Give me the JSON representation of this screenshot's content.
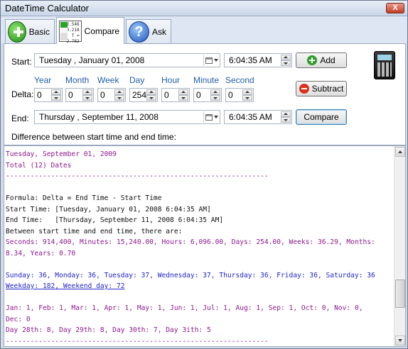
{
  "window": {
    "title": "DateTime Calculator",
    "close_label": "X"
  },
  "tabs": [
    {
      "label": "Basic",
      "icon": "plus-circle-icon"
    },
    {
      "label": "Compare",
      "icon": "compare-table-icon",
      "icon_values": [
        "2.546",
        "0.218",
        "2.782"
      ],
      "icon_eq": "T ="
    },
    {
      "label": "Ask",
      "icon": "question-icon",
      "icon_glyph": "?"
    }
  ],
  "form": {
    "start_label": "Start:",
    "start_date": "Tuesday  ,  January   01, 2008",
    "start_time": "6:04:35 AM",
    "delta_label": "Delta:",
    "delta_headers": [
      "Year",
      "Month",
      "Week",
      "Day",
      "Hour",
      "Minute",
      "Second"
    ],
    "delta_values": [
      "0",
      "0",
      "0",
      "254",
      "0",
      "0",
      "0"
    ],
    "end_label": "End:",
    "end_date": "Thursday  , September 11, 2008",
    "end_time": "6:04:35 AM",
    "diff_label": "Difference between start time and end time:"
  },
  "buttons": {
    "add": "Add",
    "subtract": "Subtract",
    "compare": "Compare"
  },
  "output": {
    "lines": [
      {
        "text": "Tuesday, September 01, 2009",
        "cls": "purple"
      },
      {
        "text": "Total (12) Dates",
        "cls": "purple"
      },
      {
        "text": "----------------------------------------------------------------",
        "cls": "sep"
      },
      {
        "text": "",
        "cls": "black"
      },
      {
        "text": "Formula: Delta = End Time - Start Time",
        "cls": "black"
      },
      {
        "text": "Start Time: [Tuesday, January 01, 2008 6:04:35 AM]",
        "cls": "black"
      },
      {
        "text": "End Time:   [Thursday, September 11, 2008 6:04:35 AM]",
        "cls": "black"
      },
      {
        "text": "Between start time and end time, there are:",
        "cls": "black"
      },
      {
        "text": "Seconds: 914,400, Minutes: 15,240.00, Hours: 6,096.00, Days: 254.00, Weeks: 36.29, Months:",
        "cls": "purple"
      },
      {
        "text": "8.34, Years: 0.70",
        "cls": "purple"
      },
      {
        "text": "",
        "cls": "black"
      },
      {
        "text": "Sunday: 36, Monday: 36, Tuesday: 37, Wednesday: 37, Thursday: 36, Friday: 36, Saturday: 36",
        "cls": "blue"
      },
      {
        "text": "Weekday: 182, Weekend day: 72",
        "cls": "blue u"
      },
      {
        "text": "",
        "cls": "black"
      },
      {
        "text": "Jan: 1, Feb: 1, Mar: 1, Apr: 1, May: 1, Jun: 1, Jul: 1, Aug: 1, Sep: 1, Oct: 0, Nov: 0,",
        "cls": "purple"
      },
      {
        "text": "Dec: 0",
        "cls": "purple"
      },
      {
        "text": "Day 28th: 8, Day 29th: 8, Day 30th: 7, Day 3ith: 5",
        "cls": "purple"
      },
      {
        "text": "----------------------------------------------------------------",
        "cls": "sep"
      }
    ]
  }
}
